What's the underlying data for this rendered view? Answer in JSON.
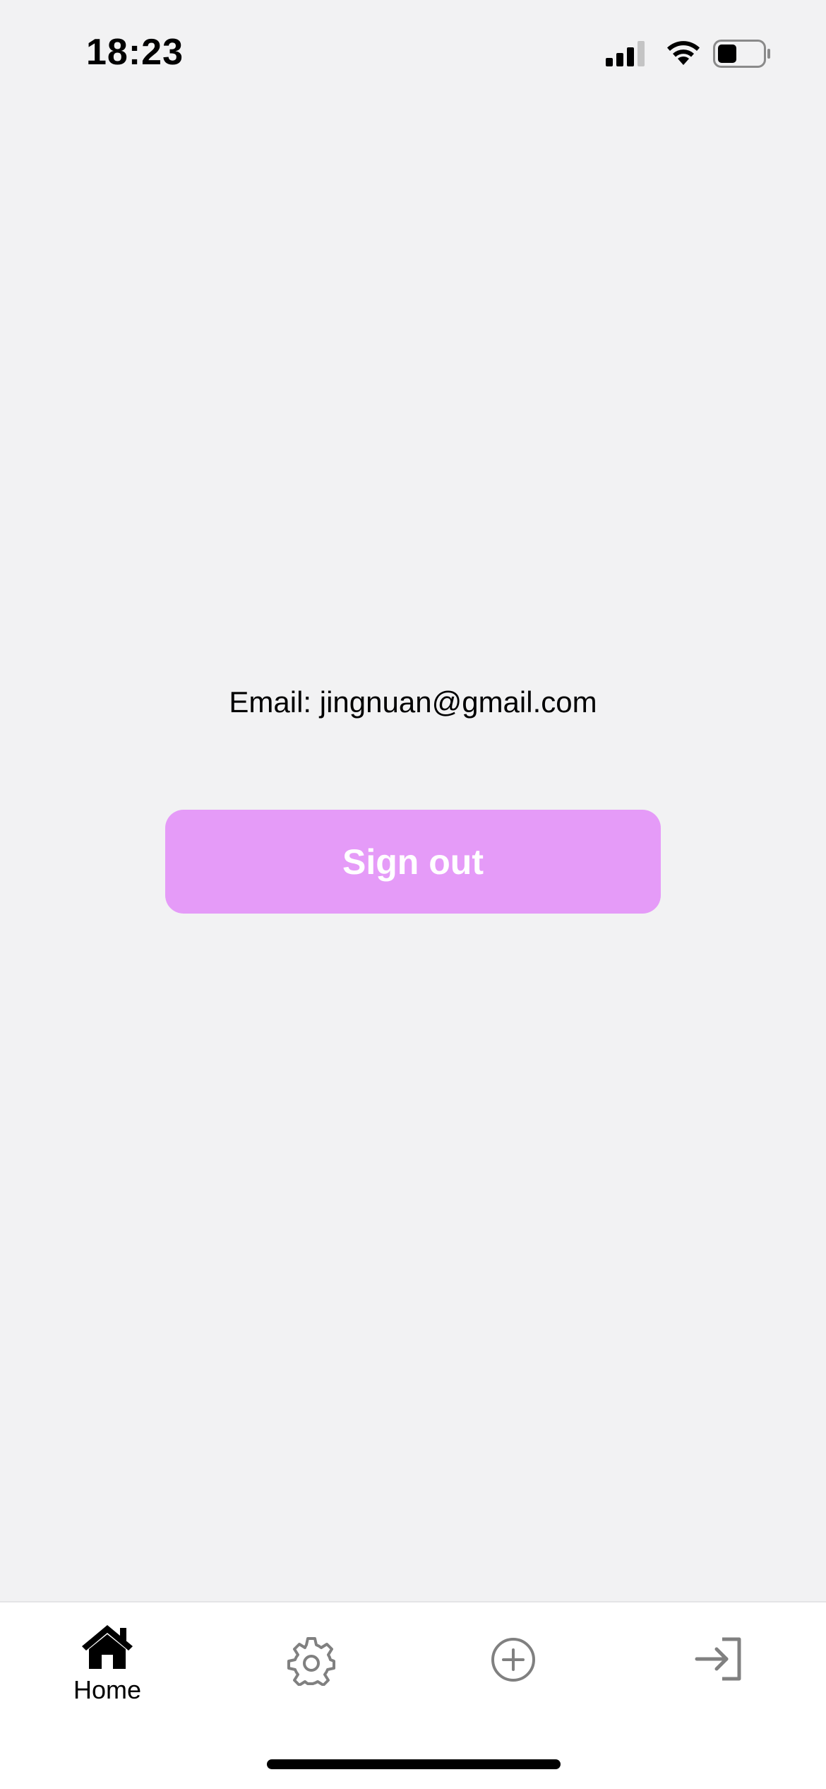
{
  "status_bar": {
    "time": "18:23",
    "icons": [
      "signal-icon",
      "wifi-icon",
      "battery-icon"
    ]
  },
  "main": {
    "email_text": "Email: jingnuan@gmail.com",
    "signout_label": "Sign out"
  },
  "tab_bar": {
    "items": [
      {
        "label": "Home",
        "icon": "home-icon",
        "active": true
      },
      {
        "label": "",
        "icon": "gear-icon",
        "active": false
      },
      {
        "label": "",
        "icon": "plus-circle-icon",
        "active": false
      },
      {
        "label": "",
        "icon": "sign-in-icon",
        "active": false
      }
    ]
  },
  "colors": {
    "background": "#f2f2f3",
    "button": "#e59bf8",
    "button_text": "#ffffff",
    "tab_bar": "#ffffff",
    "inactive_icon": "#808080"
  }
}
